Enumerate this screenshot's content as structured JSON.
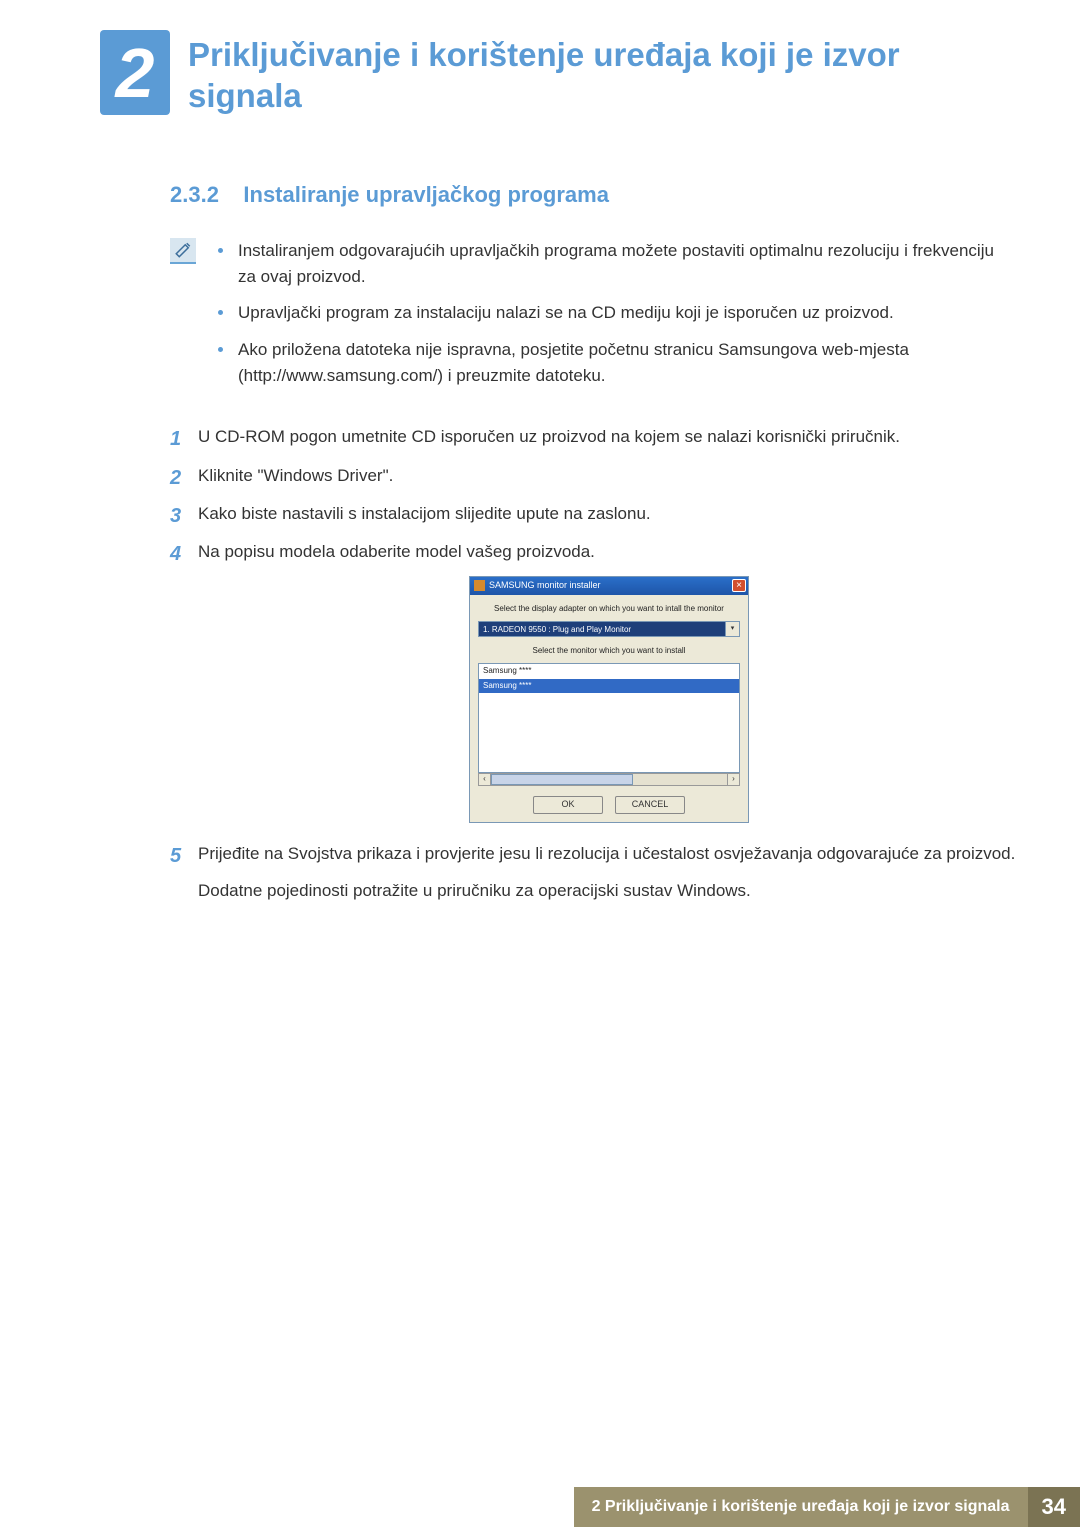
{
  "header": {
    "chapter_number": "2",
    "chapter_title": "Priključivanje i korištenje uređaja koji je izvor signala"
  },
  "section": {
    "number": "2.3.2",
    "title": "Instaliranje upravljačkog programa"
  },
  "info_bullets": [
    "Instaliranjem odgovarajućih upravljačkih programa možete postaviti optimalnu rezoluciju i frekvenciju za ovaj proizvod.",
    "Upravljački program za instalaciju nalazi se na CD mediju koji je isporučen uz proizvod.",
    "Ako priložena datoteka nije ispravna, posjetite početnu stranicu Samsungova web-mjesta (http://www.samsung.com/) i preuzmite datoteku."
  ],
  "steps": [
    {
      "num": "1",
      "text": "U CD-ROM pogon umetnite CD isporučen uz proizvod na kojem se nalazi korisnički priručnik."
    },
    {
      "num": "2",
      "text": "Kliknite \"Windows Driver\"."
    },
    {
      "num": "3",
      "text": "Kako biste nastavili s instalacijom slijedite upute na zaslonu."
    },
    {
      "num": "4",
      "text": "Na popisu modela odaberite model vašeg proizvoda."
    },
    {
      "num": "5",
      "text": "Prijeđite na Svojstva prikaza i provjerite jesu li rezolucija i učestalost osvježavanja odgovarajuće za proizvod.",
      "extra": "Dodatne pojedinosti potražite u priručniku za operacijski sustav Windows."
    }
  ],
  "installer": {
    "title": "SAMSUNG monitor installer",
    "label1": "Select the display adapter on which you want to intall the monitor",
    "combo_value": "1. RADEON 9550 : Plug and Play Monitor",
    "label2": "Select the monitor which you want to install",
    "list_items": [
      "Samsung ****",
      "Samsung ****"
    ],
    "ok": "OK",
    "cancel": "CANCEL"
  },
  "footer": {
    "text": "2 Priključivanje i korištenje uređaja koji je izvor signala",
    "page": "34"
  }
}
